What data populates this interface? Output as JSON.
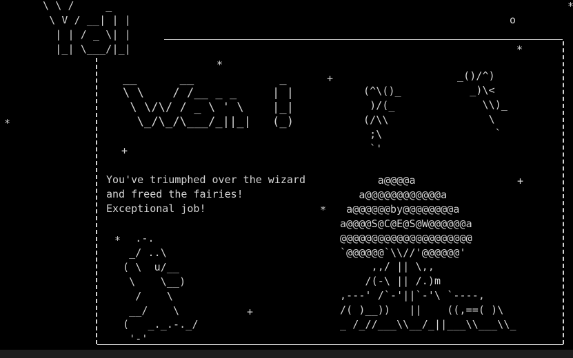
{
  "you_art": [
    "\\ \\ /     _  ",
    " \\ V / __| | |",
    "  | | / _ \\| |",
    "  |_| \\___/|_|"
  ],
  "won_art": [
    "__      __            _ ",
    "\\ \\    / /__ _ _     | |",
    " \\ \\/\\/ / _ \\ ' \\    |_|",
    "  \\_/\\_/\\___/_||_|   (_)"
  ],
  "fairy_left_art": [
    "(^\\()_",
    " )/(_",
    "(/\\\\",
    " ;\\",
    " `'"
  ],
  "fairy_right_art": [
    "_()/^)",
    "  _)\\<",
    "    \\\\)_",
    "     \\",
    "      `"
  ],
  "message": {
    "line1": "You've triumphed over the wizard",
    "line2": "and freed the fairies!",
    "line3": "Exceptional job!"
  },
  "tree_art": [
    "      a@@@@a",
    "   a@@@@@@@@@@@@a",
    " a@@@@@@by@@@@@@@@a",
    "a@@@@S@C@E@S@W@@@@@@a",
    "@@@@@@@@@@@@@@@@@@@@@",
    "`@@@@@@`\\\\//'@@@@@@'",
    "     ,,/ || \\,,",
    "    /(-\\ || /.)m",
    ",---' /`-'||`-'\\ `----,",
    "/( )__))   ||    ((,==( )\\",
    "_ /_//___\\\\__/_||___\\\\___\\\\_"
  ],
  "runner_art": [
    "  .-.",
    " _/ ..\\",
    "( \\  u/__",
    " \\    \\__)",
    "  /    \\",
    " __/    \\",
    "(   _._.-._/",
    " '-'"
  ],
  "frame": {
    "top_line": "________________________________________________",
    "side_char": "|"
  },
  "stars": {
    "star_symbol": "*",
    "plus_symbol": "+",
    "circle_symbol": "o"
  }
}
